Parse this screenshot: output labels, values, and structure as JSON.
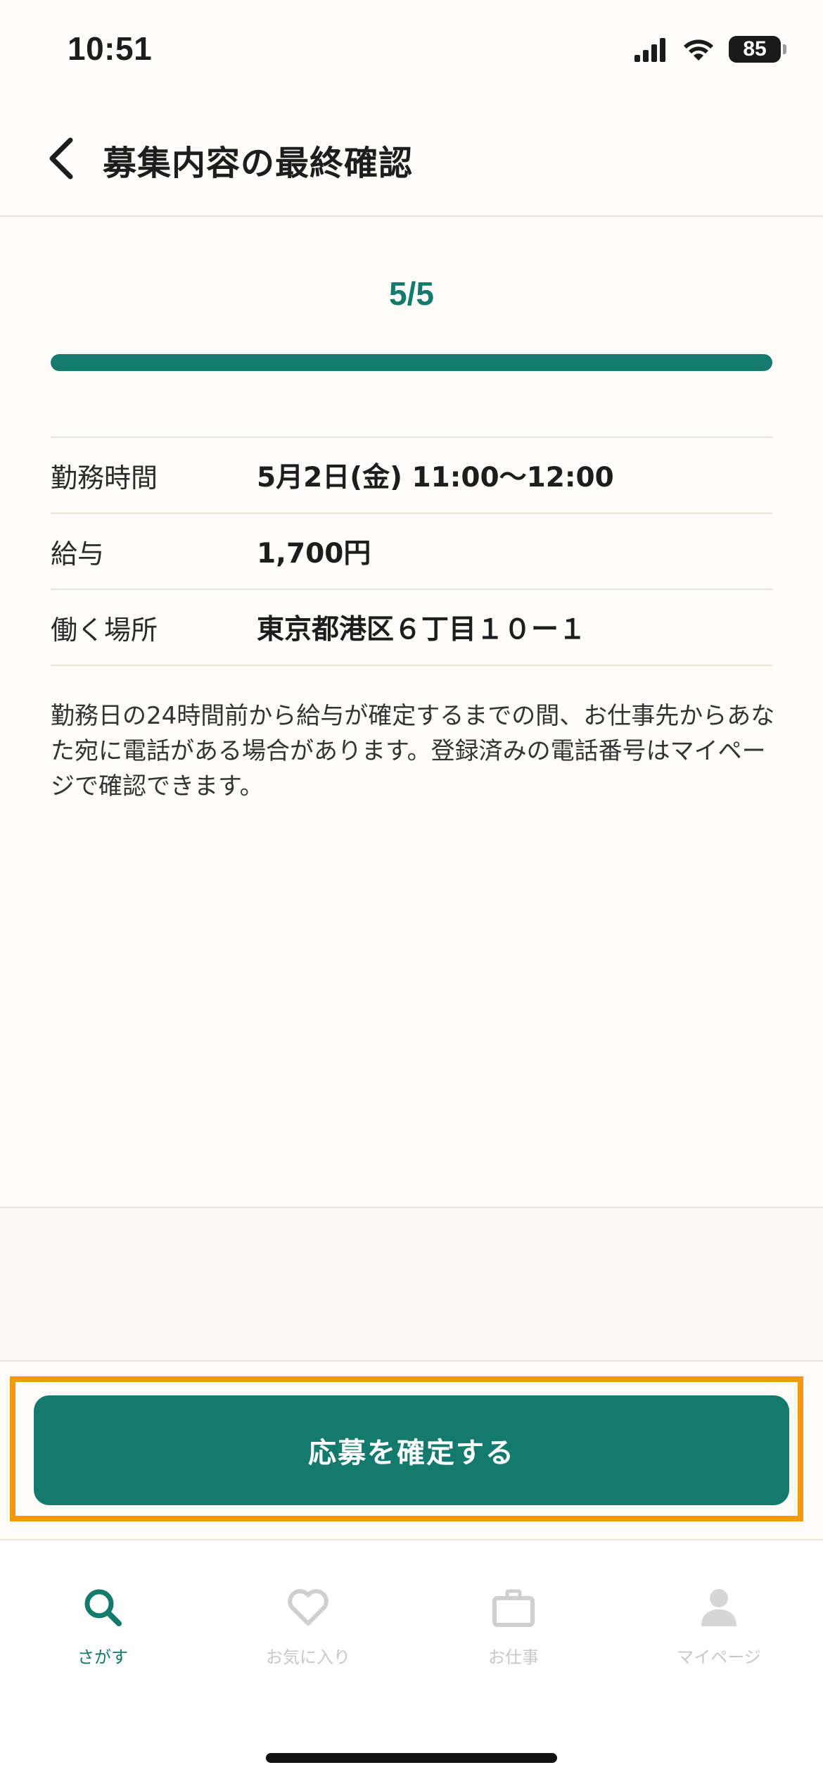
{
  "status_bar": {
    "time": "10:51",
    "battery": "85"
  },
  "header": {
    "title": "募集内容の最終確認"
  },
  "step": {
    "label": "5/5",
    "progress": 1.0
  },
  "details": [
    {
      "label": "勤務時間",
      "value": "5月2日(金) 11:00〜12:00"
    },
    {
      "label": "給与",
      "value": "1,700円"
    },
    {
      "label": "働く場所",
      "value": "東京都港区６丁目１０ー１"
    }
  ],
  "notice": "勤務日の24時間前から給与が確定するまでの間、お仕事先からあなた宛に電話がある場合があります。登録済みの電話番号はマイページで確認できます。",
  "actions": {
    "confirm_label": "応募を確定する"
  },
  "tab_bar": {
    "tabs": [
      {
        "label": "さがす",
        "icon": "search-icon",
        "active": true
      },
      {
        "label": "お気に入り",
        "icon": "heart-icon",
        "active": false
      },
      {
        "label": "お仕事",
        "icon": "briefcase-icon",
        "active": false
      },
      {
        "label": "マイページ",
        "icon": "person-icon",
        "active": false
      }
    ]
  },
  "colors": {
    "accent": "#157a6e",
    "highlight": "#f39a0b",
    "inactive": "#c8c8c8"
  }
}
